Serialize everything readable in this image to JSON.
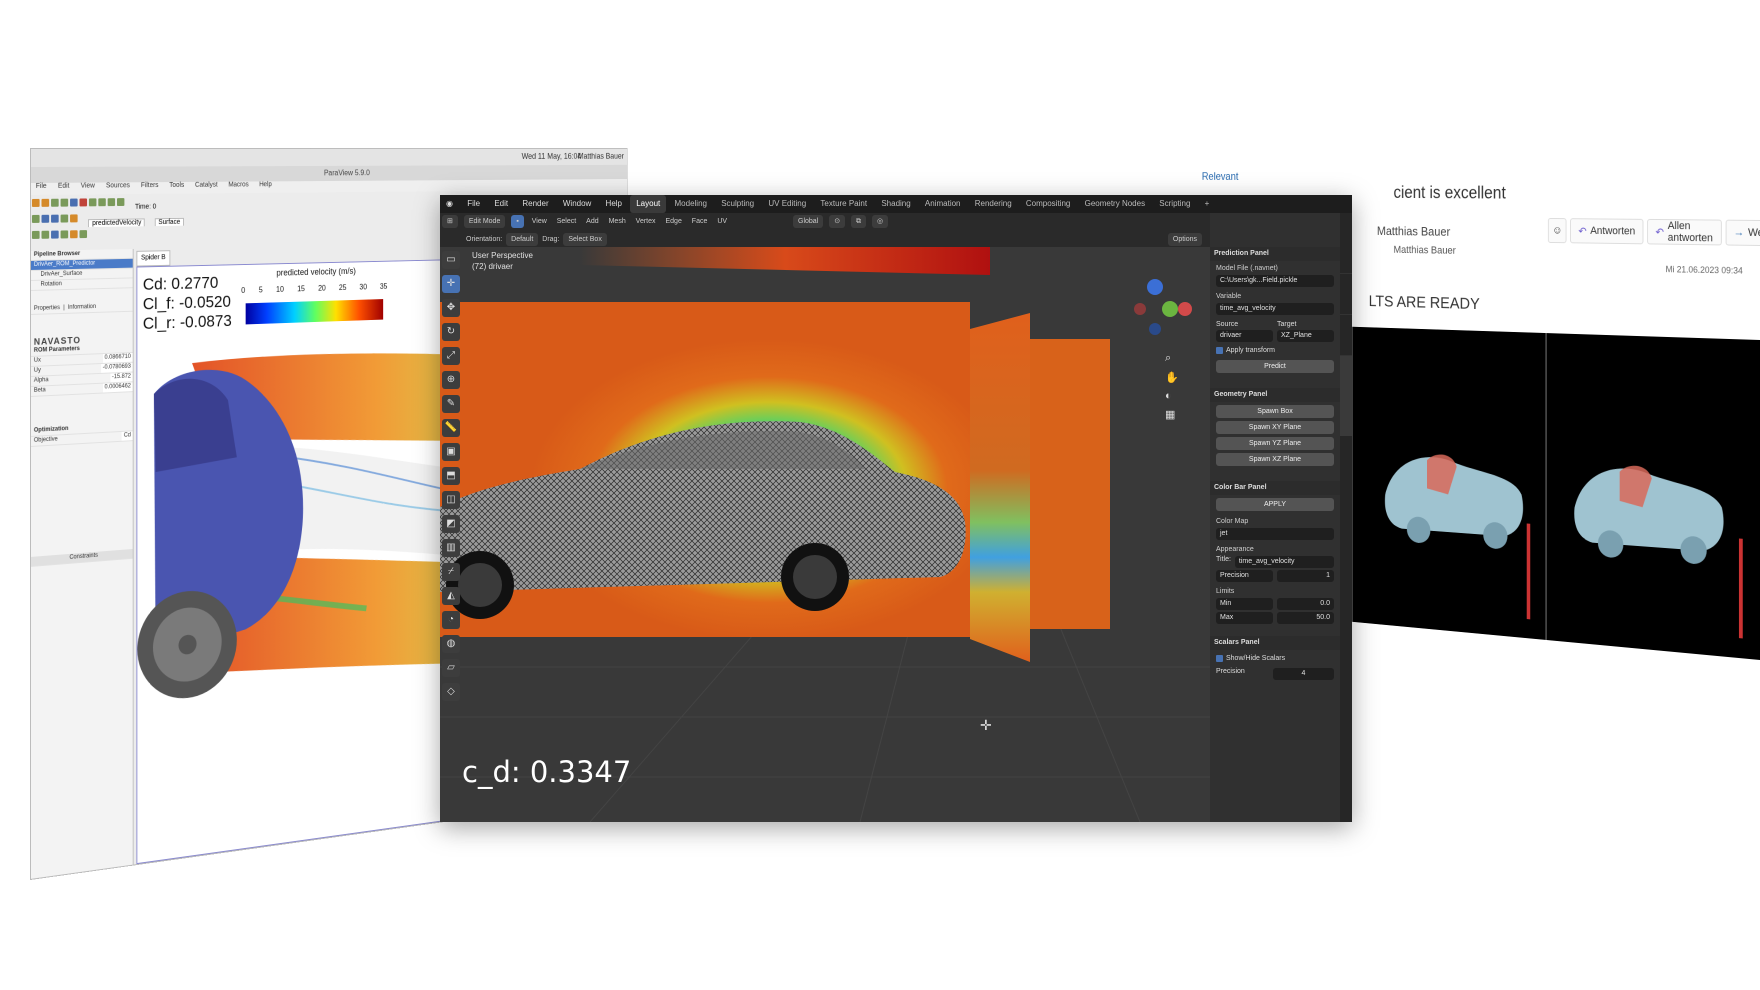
{
  "left_window": {
    "app_title": "ParaView 5.9.0",
    "system_clock": "Wed 11 May, 16:04",
    "user": "Matthias Bauer",
    "menu": [
      "File",
      "Edit",
      "View",
      "Sources",
      "Filters",
      "Tools",
      "Catalyst",
      "Macros",
      "Help"
    ],
    "time_label": "Time: 0",
    "representation": "Surface",
    "coloring": "predictedVelocity",
    "pipeline_items": [
      "DrivAer_ROM_Predictor",
      "DrivAer_Surface",
      "Rotation"
    ],
    "properties_tab": "Properties",
    "information_tab": "Information",
    "brand": "NAVASTO",
    "rom_section": "ROM Parameters",
    "params": [
      {
        "label": "Ux",
        "value": "0.0866710"
      },
      {
        "label": "Uy",
        "value": "-0.0780693"
      },
      {
        "label": "Alpha",
        "value": "-15.872"
      },
      {
        "label": "Beta",
        "value": "0.0006462"
      }
    ],
    "optimization_label": "Optimization",
    "objective_label": "Objective",
    "objective_value": "Cd",
    "constraints_label": "Constraints",
    "view_tab": "Spider B",
    "coeffs": {
      "cd": "Cd: 0.2770",
      "clf": "Cl_f: -0.0520",
      "clr": "Cl_r: -0.0873"
    },
    "colorbar_title": "predicted velocity (m/s)",
    "colorbar_ticks": [
      "0",
      "5",
      "10",
      "15",
      "20",
      "25",
      "30",
      "35"
    ]
  },
  "center_window": {
    "menu": [
      "File",
      "Edit",
      "Render",
      "Window",
      "Help"
    ],
    "workspaces": [
      "Layout",
      "Modeling",
      "Sculpting",
      "UV Editing",
      "Texture Paint",
      "Shading",
      "Animation",
      "Rendering",
      "Compositing",
      "Geometry Nodes",
      "Scripting"
    ],
    "active_workspace": "Layout",
    "mode": "Edit Mode",
    "header_menu": [
      "View",
      "Select",
      "Add",
      "Mesh",
      "Vertex",
      "Edge",
      "Face",
      "UV"
    ],
    "transform_orientation": "Global",
    "orientation_label": "Orientation:",
    "orientation_value": "Default",
    "drag_label": "Drag:",
    "drag_value": "Select Box",
    "view_name": "User Perspective",
    "object_name": "(72) drivaer",
    "options_label": "Options",
    "result_label": "c_d: 0.3347",
    "prediction_panel": {
      "title": "Prediction Panel",
      "model_file_label": "Model File (.navnet)",
      "model_file_value": "C:\\Users\\gk...Field.pickle",
      "variable_label": "Variable",
      "variable_value": "time_avg_velocity",
      "source_label": "Source",
      "target_label": "Target",
      "source_value": "drivaer",
      "target_value": "XZ_Plane",
      "apply_transform": "Apply transform",
      "predict_button": "Predict"
    },
    "geometry_panel": {
      "title": "Geometry Panel",
      "buttons": [
        "Spawn Box",
        "Spawn XY Plane",
        "Spawn YZ Plane",
        "Spawn XZ Plane"
      ]
    },
    "colorbar_panel": {
      "title": "Color Bar Panel",
      "apply_button": "APPLY",
      "color_map_label": "Color Map",
      "color_map_value": "jet",
      "appearance_label": "Appearance",
      "title_label": "Title:",
      "title_value": "time_avg_velocity",
      "precision_label": "Precision",
      "precision_value": "1",
      "limits_label": "Limits",
      "min_label": "Min",
      "min_value": "0.0",
      "max_label": "Max",
      "max_value": "50.0"
    },
    "scalars_panel": {
      "title": "Scalars Panel",
      "show_hide": "Show/Hide Scalars",
      "precision_label": "Precision",
      "precision_value": "4"
    }
  },
  "right_window": {
    "heading_fragment": "cient is excellent",
    "sender": "Matthias Bauer",
    "recipient": "Matthias Bauer",
    "buttons": [
      "Antworten",
      "Allen antworten",
      "Weiterleiten"
    ],
    "date": "Mi 21.06.2023 09:34",
    "body_heading": "LTS ARE READY",
    "top_fragment": "Relevant"
  },
  "colors": {
    "blender_bg": "#393939",
    "blender_accent": "#4772b3",
    "outlook_link": "#2b6cb0"
  }
}
